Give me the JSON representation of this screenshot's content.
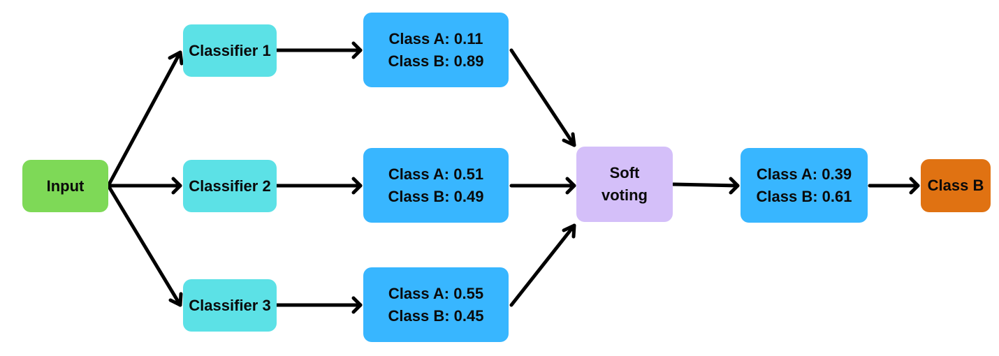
{
  "input": {
    "label": "Input"
  },
  "classifiers": [
    {
      "label": "Classifier 1",
      "class_a": "Class A: 0.11",
      "class_b": "Class B: 0.89"
    },
    {
      "label": "Classifier 2",
      "class_a": "Class A: 0.51",
      "class_b": "Class B: 0.49"
    },
    {
      "label": "Classifier 3",
      "class_a": "Class A: 0.55",
      "class_b": "Class B: 0.45"
    }
  ],
  "voting": {
    "line1": "Soft",
    "line2": "voting"
  },
  "averaged": {
    "class_a": "Class A: 0.39",
    "class_b": "Class B: 0.61"
  },
  "output": {
    "label": "Class B"
  },
  "colors": {
    "input": "#7ed957",
    "classifier": "#5ce1e6",
    "probabilities": "#38b6ff",
    "voting": "#d4bff9",
    "output": "#e07212"
  }
}
